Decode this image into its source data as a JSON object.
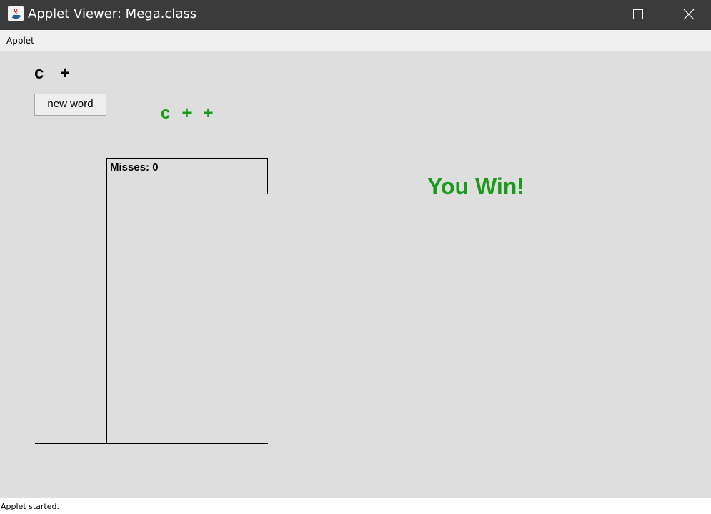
{
  "window": {
    "title": "Applet Viewer: Mega.class",
    "app_icon": "java-icon",
    "controls": [
      "minimize-icon",
      "maximize-icon",
      "close-icon"
    ]
  },
  "menubar": {
    "items": [
      {
        "label": "Applet"
      }
    ]
  },
  "applet": {
    "guessed_letters": "c +",
    "new_word_label": "new word",
    "word_slots": [
      "c",
      "+",
      "+"
    ],
    "misses_label": "Misses: 0",
    "result_message": "You Win!",
    "result_color": "#1a9a1a"
  },
  "status": {
    "text": "Applet started."
  }
}
